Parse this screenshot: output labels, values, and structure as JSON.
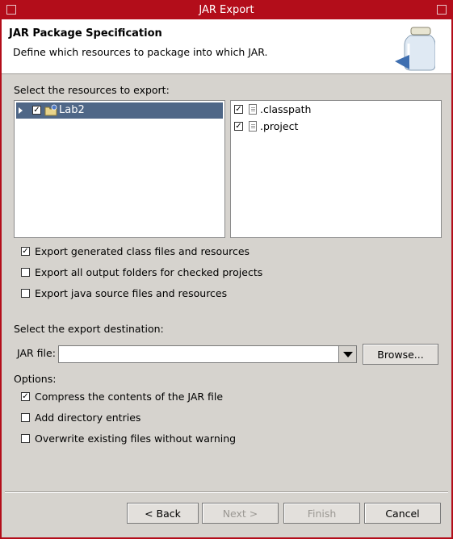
{
  "window": {
    "title": "JAR Export"
  },
  "banner": {
    "title": "JAR Package Specification",
    "description": "Define which resources to package into which JAR."
  },
  "resources": {
    "label": "Select the resources to export:",
    "tree": [
      {
        "label": "Lab2",
        "checked": true,
        "selected": true,
        "icon": "java-project-icon"
      }
    ],
    "files": [
      {
        "label": ".classpath",
        "checked": true,
        "icon": "file-icon"
      },
      {
        "label": ".project",
        "checked": true,
        "icon": "file-icon"
      }
    ]
  },
  "export_options": [
    {
      "label": "Export generated class files and resources",
      "checked": true
    },
    {
      "label": "Export all output folders for checked projects",
      "checked": false
    },
    {
      "label": "Export java source files and resources",
      "checked": false
    }
  ],
  "destination": {
    "label": "Select the export destination:",
    "jar_file_label": "JAR file:",
    "jar_file_value": "",
    "browse_label": "Browse..."
  },
  "options": {
    "label": "Options:",
    "items": [
      {
        "label": "Compress the contents of the JAR file",
        "checked": true
      },
      {
        "label": "Add directory entries",
        "checked": false
      },
      {
        "label": "Overwrite existing files without warning",
        "checked": false
      }
    ]
  },
  "buttons": {
    "back": "< Back",
    "next": "Next >",
    "finish": "Finish",
    "cancel": "Cancel"
  },
  "colors": {
    "title_bar": "#b30d1a",
    "selection": "#4f6787",
    "dialog_bg": "#d6d3ce"
  }
}
